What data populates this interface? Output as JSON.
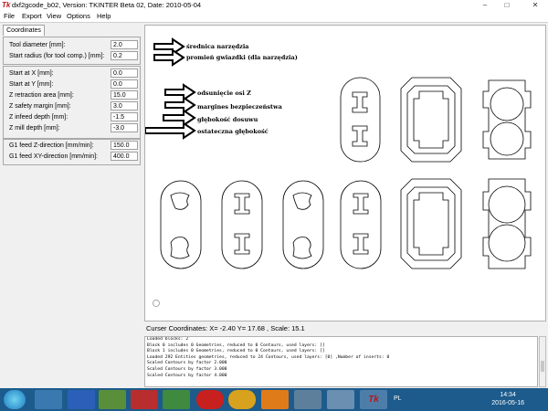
{
  "window": {
    "title": "dxf2gcode_b02, Version: TKINTER Beta 02, Date: 2010-05-04",
    "logo": "Tk",
    "minimize": "–",
    "maximize": "□",
    "close": "✕"
  },
  "menu": [
    "File",
    "Export",
    "View",
    "Options",
    "Help"
  ],
  "tab": "Coordinates",
  "panels": {
    "tool": [
      {
        "label": "Tool diameter [mm]:",
        "value": "2.0"
      },
      {
        "label": "Start radius (for tool comp.) [mm]:",
        "value": "0.2"
      }
    ],
    "start": [
      {
        "label": "Start at X [mm]:",
        "value": "0.0"
      },
      {
        "label": "Start at Y [mm]:",
        "value": "0.0"
      },
      {
        "label": "Z retraction area [mm]:",
        "value": "15.0"
      },
      {
        "label": "Z safety margin [mm]:",
        "value": "3.0"
      },
      {
        "label": "Z infeed depth [mm]:",
        "value": "-1.5"
      },
      {
        "label": "Z mill depth [mm]:",
        "value": "-3.0"
      }
    ],
    "feed": [
      {
        "label": "G1 feed Z-direction [mm/min]:",
        "value": "150.0"
      },
      {
        "label": "G1 feed XY-direction [mm/min]:",
        "value": "400.0"
      }
    ]
  },
  "annotations": [
    "średnica narzędzia",
    "promień gwiazdki (dla narzędzia)",
    "odsunięcie osi Z",
    "margines bezpieczeństwa",
    "głębokość dosuwu",
    "ostateczna głębokość"
  ],
  "status": {
    "coordinates": "Curser Coordinates: X= -2.40 Y= 17.68 , Scale: 15.1"
  },
  "log": [
    "Loaded blocks: 2",
    "Block 0 includes 0 Geometries, reduced to 0 Contours, used layers: []",
    "Block 1 includes 0 Geometries, reduced to 0 Contours, used layers: []",
    "Loaded 292 Entities geometries, reduced to 24 Contours, used layers: [0] ,Number of inserts: 0",
    "Scaled Contours by factor 2.000",
    "Scaled Contours by factor 3.000",
    "Scaled Contours by factor 4.000"
  ],
  "taskbar": {
    "lang": "PL",
    "time": "14:34",
    "date": "2016-05-16"
  },
  "colors": {
    "taskbar": "#1c5b8c",
    "canvas": "#ffffff",
    "logo": "#c0141a"
  }
}
